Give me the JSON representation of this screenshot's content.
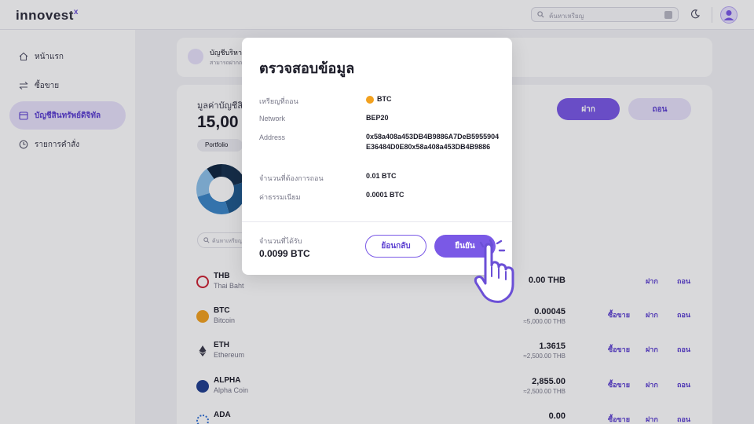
{
  "app": {
    "logo_text": "innovest",
    "logo_mark": "x"
  },
  "header": {
    "search_placeholder": "ค้นหาเหรียญ"
  },
  "sidebar": {
    "items": [
      {
        "label": "หน้าแรก",
        "active": false
      },
      {
        "label": "ซื้อขาย",
        "active": false
      },
      {
        "label": "บัญชีสินทรัพย์ดิจิทัล",
        "active": true
      },
      {
        "label": "รายการคำสั่ง",
        "active": false
      }
    ]
  },
  "account_card": {
    "title": "บัญชีบริหา",
    "subtitle": "สามารถฝากถอน"
  },
  "portfolio": {
    "label": "มูลค่าบัญชีสิน",
    "total": "15,00",
    "chip": "Portfolio",
    "deposit_label": "ฝาก",
    "withdraw_label": "ถอน",
    "list_search_placeholder": "ค้นหาเหรียญ",
    "donut": {
      "colors": [
        "#16314f",
        "#1f5b8f",
        "#3b86c7",
        "#8dc1ea",
        "#0f2540"
      ],
      "shares": [
        0.2,
        0.25,
        0.25,
        0.2,
        0.1
      ]
    }
  },
  "assets": [
    {
      "symbol": "THB",
      "name": "Thai Baht",
      "amount": "0.00 THB",
      "fiat": "",
      "trade": "",
      "deposit": "ฝาก",
      "withdraw": "ถอน",
      "color": "#cc2233"
    },
    {
      "symbol": "BTC",
      "name": "Bitcoin",
      "amount": "0.00045",
      "fiat": "≈5,000.00 THB",
      "trade": "ซื้อขาย",
      "deposit": "ฝาก",
      "withdraw": "ถอน",
      "color": "#f2a11f"
    },
    {
      "symbol": "ETH",
      "name": "Ethereum",
      "amount": "1.3615",
      "fiat": "≈2,500.00 THB",
      "trade": "ซื้อขาย",
      "deposit": "ฝาก",
      "withdraw": "ถอน",
      "color": "#3a3a4a"
    },
    {
      "symbol": "ALPHA",
      "name": "Alpha Coin",
      "amount": "2,855.00",
      "fiat": "≈2,500.00 THB",
      "trade": "ซื้อขาย",
      "deposit": "ฝาก",
      "withdraw": "ถอน",
      "color": "#1f3f8f"
    },
    {
      "symbol": "ADA",
      "name": "",
      "amount": "0.00",
      "fiat": "",
      "trade": "ซื้อขาย",
      "deposit": "ฝาก",
      "withdraw": "ถอน",
      "color": "#2f6fd6"
    }
  ],
  "modal": {
    "title": "ตรวจสอบข้อมูล",
    "coin_label": "เหรียญที่ถอน",
    "coin_value": "BTC",
    "network_label": "Network",
    "network_value": "BEP20",
    "address_label": "Address",
    "address_value": "0x58a408a453DB4B9886A7DeB5955904E36484D0E80x58a408a453DB4B9886",
    "amount_label": "จำนวนที่ต้องการถอน",
    "amount_value": "0.01 BTC",
    "fee_label": "ค่าธรรมเนียม",
    "fee_value": "0.0001 BTC",
    "receive_label": "จำนวนที่ได้รับ",
    "receive_value": "0.0099 BTC",
    "back_label": "ย้อนกลับ",
    "confirm_label": "ยืนยัน"
  }
}
